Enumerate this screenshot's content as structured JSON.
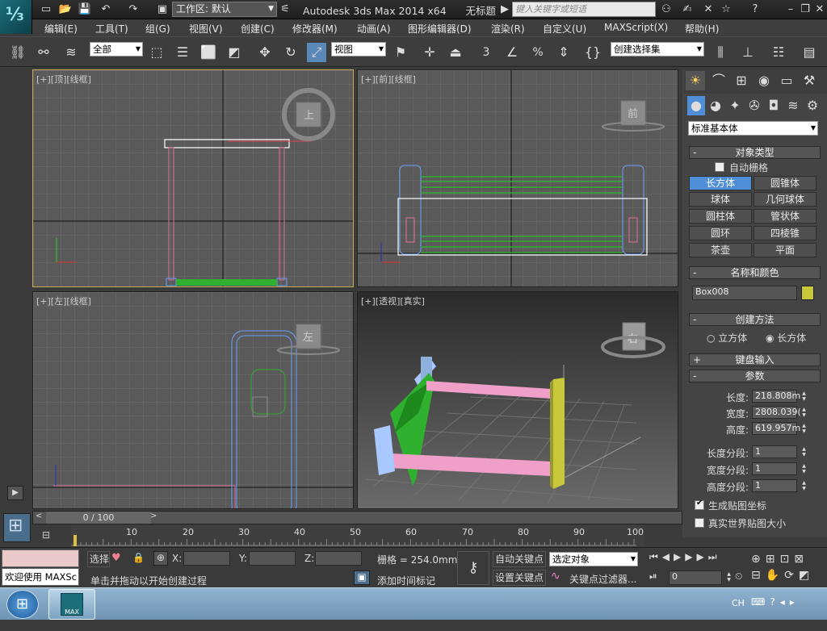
{
  "window": {
    "app_title": "Autodesk 3ds Max  2014 x64",
    "doc_title": "无标题",
    "workspace_value": "工作区: 默认",
    "search_placeholder": "键入关键字或短语",
    "logo_glyph": "⅓"
  },
  "menubar": [
    "编辑(E)",
    "工具(T)",
    "组(G)",
    "视图(V)",
    "创建(C)",
    "修改器(M)",
    "动画(A)",
    "图形编辑器(D)",
    "渲染(R)",
    "自定义(U)",
    "MAXScript(X)",
    "帮助(H)"
  ],
  "toolbar": {
    "selection_filter": "全部",
    "ref_coord": "视图",
    "named_selection": "创建选择集",
    "snap_label": "3",
    "percent_label": "%"
  },
  "viewports": {
    "top": "[+][顶][线框]",
    "front": "[+][前][线框]",
    "left": "[+][左][线框]",
    "persp": "[+][透视][真实]",
    "cube_top": "上",
    "cube_front": "前",
    "cube_left": "左",
    "cube_persp": "右"
  },
  "command_panel": {
    "category": "标准基本体",
    "object_type_header": "对象类型",
    "autogrid_label": "自动栅格",
    "object_buttons": [
      "长方体",
      "圆锥体",
      "球体",
      "几何球体",
      "圆柱体",
      "管状体",
      "圆环",
      "四棱锥",
      "茶壶",
      "平面"
    ],
    "name_color_header": "名称和颜色",
    "object_name": "Box008",
    "object_color": "#c8c83a",
    "creation_header": "创建方法",
    "creation_cube": "立方体",
    "creation_box": "长方体",
    "keyboard_header": "键盘输入",
    "params_header": "参数",
    "length_label": "长度:",
    "length_value": "218.808m",
    "width_label": "宽度:",
    "width_value": "2808.039(",
    "height_label": "高度:",
    "height_value": "619.957m",
    "len_seg_label": "长度分段:",
    "len_seg_value": "1",
    "wid_seg_label": "宽度分段:",
    "wid_seg_value": "1",
    "hei_seg_label": "高度分段:",
    "hei_seg_value": "1",
    "gen_map_label": "生成贴图坐标",
    "real_world_label": "真实世界贴图大小"
  },
  "timeline": {
    "frame_label": "0 / 100",
    "ticks": [
      "10",
      "20",
      "30",
      "40",
      "50",
      "60",
      "70",
      "80",
      "90",
      "100"
    ]
  },
  "status": {
    "maxscript_text": "欢迎使用  MAXSc",
    "select_label": "选择",
    "x_label": "X:",
    "y_label": "Y:",
    "z_label": "Z:",
    "grid_text": "栅格 = 254.0mm",
    "prompt_text": "单击并拖动以开始创建过程",
    "add_time_tag": "添加时间标记",
    "auto_key": "自动关键点",
    "set_key": "设置关键点",
    "key_mode_value": "选定对象",
    "key_filters": "关键点过滤器...",
    "frame_value": "0"
  },
  "taskbar": {
    "lang": "CH",
    "max_label": "MAX"
  }
}
